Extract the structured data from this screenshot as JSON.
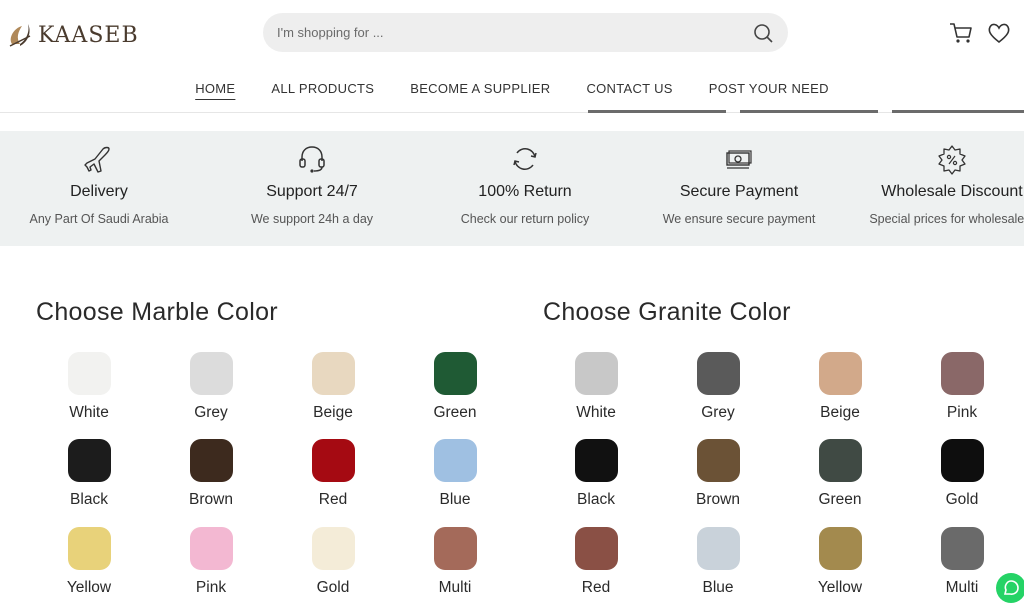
{
  "brand": {
    "name": "KAASEB"
  },
  "search": {
    "placeholder": "I'm shopping for ..."
  },
  "nav": [
    {
      "label": "HOME",
      "active": true
    },
    {
      "label": "ALL PRODUCTS",
      "active": false
    },
    {
      "label": "BECOME A SUPPLIER",
      "active": false
    },
    {
      "label": "CONTACT US",
      "active": false
    },
    {
      "label": "POST YOUR NEED",
      "active": false
    }
  ],
  "features": [
    {
      "icon": "airplane-icon",
      "title": "Delivery",
      "subtitle": "Any Part Of Saudi Arabia"
    },
    {
      "icon": "headset-icon",
      "title": "Support 24/7",
      "subtitle": "We support 24h a day"
    },
    {
      "icon": "refresh-icon",
      "title": "100% Return",
      "subtitle": "Check our return policy"
    },
    {
      "icon": "money-icon",
      "title": "Secure Payment",
      "subtitle": "We ensure secure payment"
    },
    {
      "icon": "discount-badge-icon",
      "title": "Wholesale Discount",
      "subtitle": "Special prices for wholesalers"
    }
  ],
  "marble": {
    "title": "Choose Marble Color",
    "colors": [
      {
        "label": "White",
        "swatch": "#f2f2f0"
      },
      {
        "label": "Grey",
        "swatch": "#dcdcdc"
      },
      {
        "label": "Beige",
        "swatch": "#e8d8c0"
      },
      {
        "label": "Green",
        "swatch": "#1f5a34"
      },
      {
        "label": "Black",
        "swatch": "#1c1c1c"
      },
      {
        "label": "Brown",
        "swatch": "#3d2a1e"
      },
      {
        "label": "Red",
        "swatch": "#a50a12"
      },
      {
        "label": "Blue",
        "swatch": "#9fc0e2"
      },
      {
        "label": "Yellow",
        "swatch": "#e8d27a"
      },
      {
        "label": "Pink",
        "swatch": "#f3b8d2"
      },
      {
        "label": "Gold",
        "swatch": "#f4ecd8"
      },
      {
        "label": "Multi",
        "swatch": "#a46a5a"
      }
    ]
  },
  "granite": {
    "title": "Choose Granite Color",
    "colors": [
      {
        "label": "White",
        "swatch": "#c8c8c8"
      },
      {
        "label": "Grey",
        "swatch": "#5a5a5a"
      },
      {
        "label": "Beige",
        "swatch": "#d2a98a"
      },
      {
        "label": "Pink",
        "swatch": "#8a6868"
      },
      {
        "label": "Black",
        "swatch": "#111111"
      },
      {
        "label": "Brown",
        "swatch": "#6b5236"
      },
      {
        "label": "Green",
        "swatch": "#404a44"
      },
      {
        "label": "Gold",
        "swatch": "#0e0e0e"
      },
      {
        "label": "Red",
        "swatch": "#8a5045"
      },
      {
        "label": "Blue",
        "swatch": "#c9d2da"
      },
      {
        "label": "Yellow",
        "swatch": "#a38a4e"
      },
      {
        "label": "Multi",
        "swatch": "#6a6a6a"
      }
    ]
  },
  "colors": {
    "feature_bg": "#eef1f1",
    "whatsapp": "#25d366"
  }
}
